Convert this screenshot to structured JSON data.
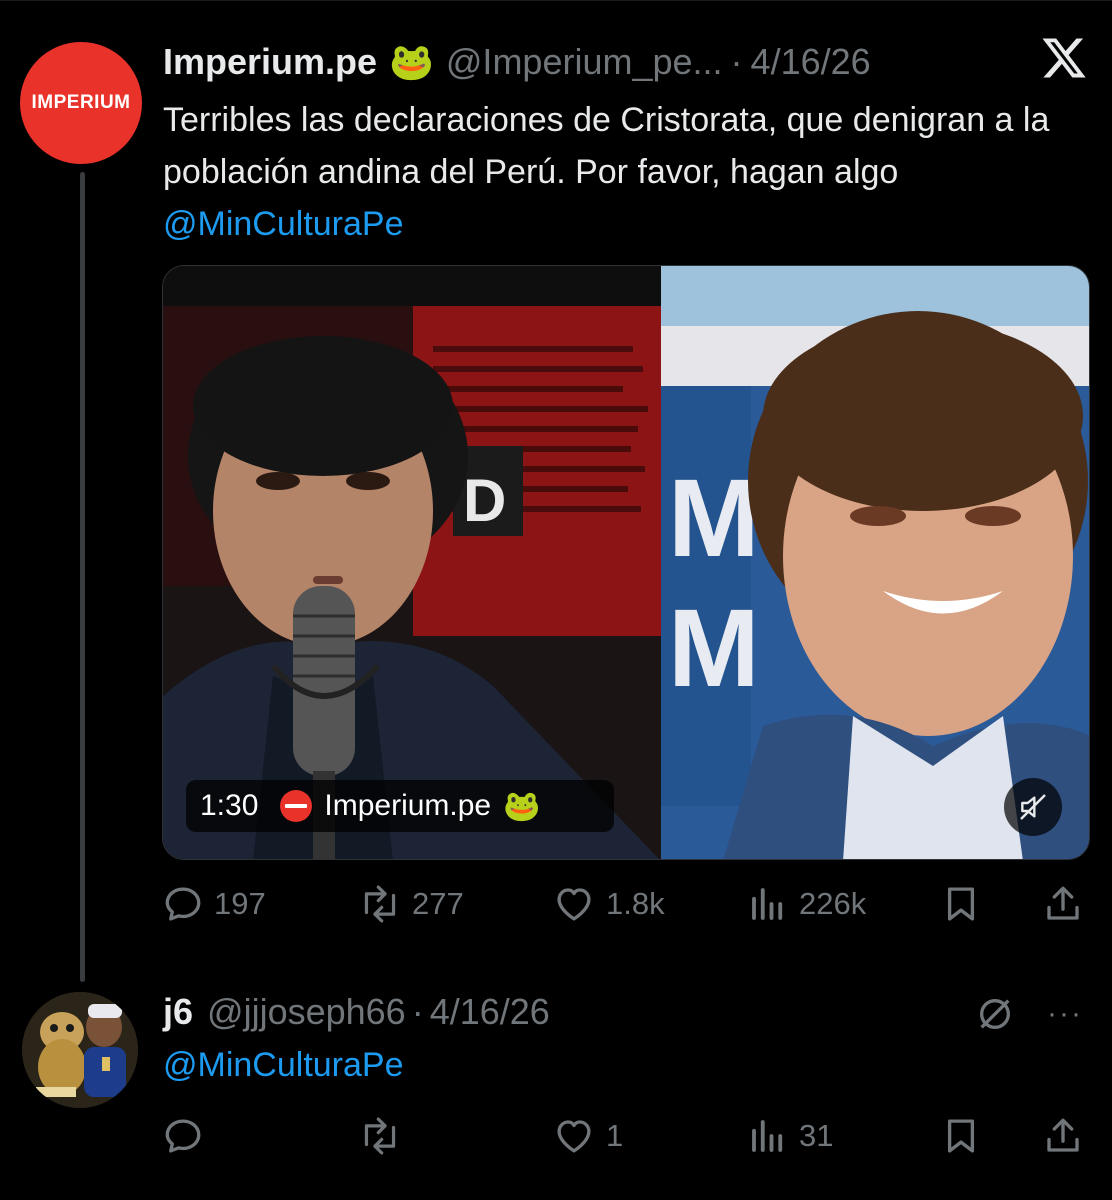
{
  "main_tweet": {
    "avatar_text": "IMPERIUM",
    "name": "Imperium.pe",
    "name_emoji": "🐸",
    "handle": "@Imperium_pe...",
    "separator": "·",
    "date": "4/16/26",
    "text_before_mention": "Terribles las declaraciones de Cristorata, que denigran a la población andina del Perú. Por favor, hagan algo ",
    "mention": "@MinCulturaPe",
    "video": {
      "duration": "1:30",
      "channel": "Imperium.pe",
      "channel_emoji": "🐸"
    },
    "stats": {
      "replies": "197",
      "reposts": "277",
      "likes": "1.8k",
      "views": "226k"
    }
  },
  "reply_tweet": {
    "name": "j6",
    "handle": "@jjjoseph66",
    "separator": "·",
    "date": "4/16/26",
    "text": "@MinCulturaPe",
    "stats": {
      "replies": "",
      "reposts": "",
      "likes": "1",
      "views": "31"
    }
  },
  "colors": {
    "background": "#000000",
    "text_primary": "#e7e9ea",
    "text_secondary": "#71767b",
    "link": "#1d9bf0",
    "brand_red": "#e8322a"
  },
  "icons": [
    "x-logo-icon",
    "reply-icon",
    "repost-icon",
    "like-icon",
    "views-icon",
    "bookmark-icon",
    "share-icon",
    "mute-icon",
    "grok-icon",
    "more-icon"
  ]
}
